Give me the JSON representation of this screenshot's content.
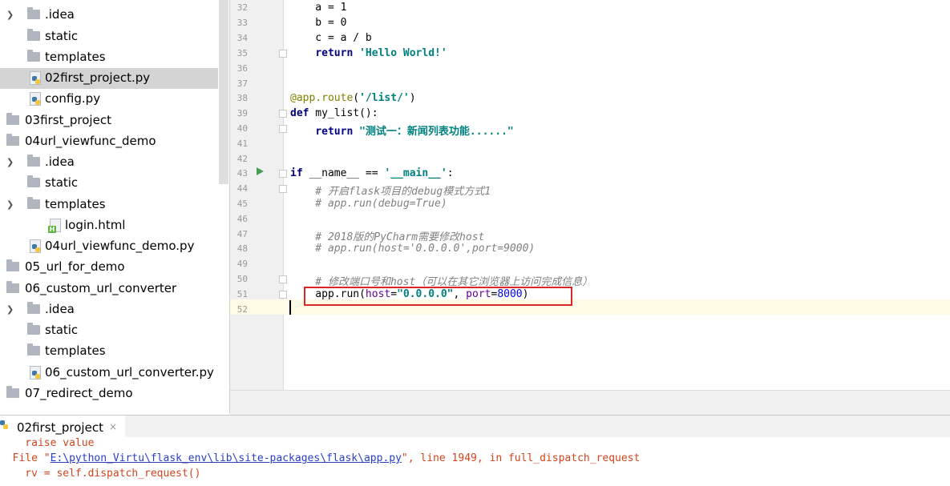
{
  "project_tree": {
    "items": [
      {
        "label": ".idea",
        "type": "folder",
        "level": 1,
        "expandable": true,
        "expanded": false
      },
      {
        "label": "static",
        "type": "folder",
        "level": 1,
        "expandable": false,
        "expanded": false
      },
      {
        "label": "templates",
        "type": "folder",
        "level": 1,
        "expandable": false,
        "expanded": false
      },
      {
        "label": "02first_project.py",
        "type": "python-file",
        "level": 1,
        "selected": true
      },
      {
        "label": "config.py",
        "type": "python-file",
        "level": 1
      },
      {
        "label": "03first_project",
        "type": "folder",
        "level": 0,
        "expandable": false
      },
      {
        "label": "04url_viewfunc_demo",
        "type": "folder",
        "level": 0,
        "expandable": false
      },
      {
        "label": ".idea",
        "type": "folder",
        "level": 1,
        "expandable": true,
        "expanded": false
      },
      {
        "label": "static",
        "type": "folder",
        "level": 1,
        "expandable": false
      },
      {
        "label": "templates",
        "type": "folder",
        "level": 1,
        "expandable": true,
        "expanded": true
      },
      {
        "label": "login.html",
        "type": "html-file",
        "level": 2
      },
      {
        "label": "04url_viewfunc_demo.py",
        "type": "python-file",
        "level": 1
      },
      {
        "label": "05_url_for_demo",
        "type": "folder",
        "level": 0
      },
      {
        "label": "06_custom_url_converter",
        "type": "folder",
        "level": 0
      },
      {
        "label": ".idea",
        "type": "folder",
        "level": 1,
        "expandable": true,
        "expanded": false
      },
      {
        "label": "static",
        "type": "folder",
        "level": 1
      },
      {
        "label": "templates",
        "type": "folder",
        "level": 1
      },
      {
        "label": "06_custom_url_converter.py",
        "type": "python-file",
        "level": 1
      },
      {
        "label": "07_redirect_demo",
        "type": "folder",
        "level": 0
      }
    ]
  },
  "editor": {
    "current_line": "52",
    "lines": [
      {
        "n": "32",
        "text": "    a = 1"
      },
      {
        "n": "33",
        "text": "    b = 0"
      },
      {
        "n": "34",
        "text": "    c = a / b"
      },
      {
        "n": "35",
        "text": "    return 'Hello World!'"
      },
      {
        "n": "36",
        "text": ""
      },
      {
        "n": "37",
        "text": ""
      },
      {
        "n": "38",
        "text": "@app.route('/list/')"
      },
      {
        "n": "39",
        "text": "def my_list():"
      },
      {
        "n": "40",
        "text": "    return \"测试一：新闻列表功能......\""
      },
      {
        "n": "41",
        "text": ""
      },
      {
        "n": "42",
        "text": ""
      },
      {
        "n": "43",
        "text": "if __name__ == '__main__':"
      },
      {
        "n": "44",
        "text": "    # 开启flask项目的debug模式方式1"
      },
      {
        "n": "45",
        "text": "    # app.run(debug=True)"
      },
      {
        "n": "46",
        "text": ""
      },
      {
        "n": "47",
        "text": "    # 2018版的PyCharm需要修改host"
      },
      {
        "n": "48",
        "text": "    # app.run(host='0.0.0.0',port=9000)"
      },
      {
        "n": "49",
        "text": ""
      },
      {
        "n": "50",
        "text": "    # 修改端口号和host（可以在其它浏览器上访问完成信息）"
      },
      {
        "n": "51",
        "text": "    app.run(host=\"0.0.0.0\", port=8000)"
      },
      {
        "n": "52",
        "text": ""
      }
    ]
  },
  "run_panel": {
    "tab_label": "02first_project",
    "close_label": "×",
    "console": {
      "line1": "    raise value",
      "line2_prefix": "  File \"",
      "line2_link": "E:\\python_Virtu\\flask_env\\lib\\site-packages\\flask\\app.py",
      "line2_suffix": "\", line 1949, in full_dispatch_request",
      "line3": "    rv = self.dispatch_request()"
    }
  },
  "colors": {
    "keyword": "#000080",
    "string": "#008080",
    "comment": "#808080",
    "decorator": "#808000",
    "highlight_box": "#d9262b",
    "console_text": "#d2451e",
    "console_link": "#2a3fc8"
  }
}
